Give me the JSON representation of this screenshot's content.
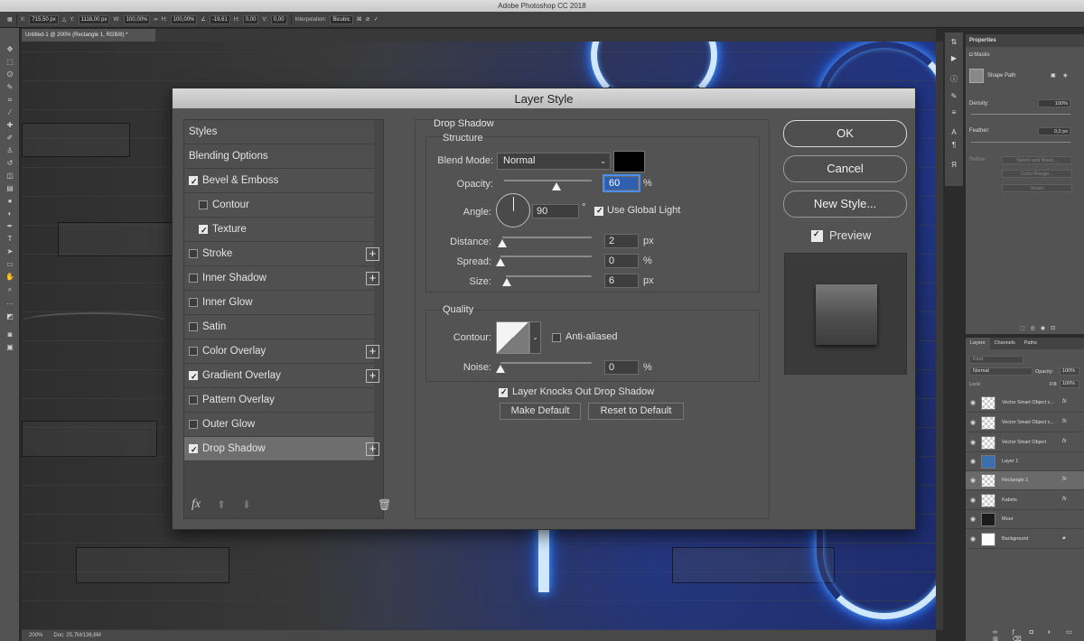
{
  "app": {
    "title": "Adobe Photoshop CC 2018"
  },
  "options_bar": {
    "x_label": "X:",
    "x_value": "715,50 px",
    "y_label": "Y:",
    "y_value": "1118,00 px",
    "w_label": "W:",
    "w_value": "100,00%",
    "h_label": "H:",
    "h_value": "100,00%",
    "angle_value": "-19,61",
    "hskew_label": "H:",
    "hskew_value": "0,00",
    "vskew_label": "V:",
    "vskew_value": "0,00",
    "interp_label": "Interpolation:",
    "interp_value": "Bicubic"
  },
  "document": {
    "tab": "Untitled-1 @ 200% (Rectangle 1, RGB/8) *"
  },
  "status": {
    "zoom": "200%",
    "doc": "Doc: 25,7M/136,6M"
  },
  "properties": {
    "title": "Properties",
    "masks": "Masks",
    "shape_path": "Shape Path",
    "density_label": "Density:",
    "density_value": "100%",
    "feather_label": "Feather:",
    "feather_value": "0,0 px",
    "refine_label": "Refine:",
    "btn_select_mask": "Select and Mask...",
    "btn_color_range": "Color Range...",
    "btn_invert": "Invert"
  },
  "layers_panel": {
    "tabs": [
      "Layers",
      "Channels",
      "Paths"
    ],
    "kind": "Kind",
    "blend": "Normal",
    "opacity_label": "Opacity:",
    "opacity_value": "100%",
    "lock_label": "Lock:",
    "fill_label": "Fill:",
    "fill_value": "100%",
    "layers": [
      {
        "name": "Vector Smart Object c...",
        "fx": "fx"
      },
      {
        "name": "Vector Smart Object c...",
        "fx": "fx"
      },
      {
        "name": "Vector Smart Object",
        "fx": "fx"
      },
      {
        "name": "Layer 1",
        "fx": ""
      },
      {
        "name": "Rectangle 1",
        "fx": "fx"
      },
      {
        "name": "Kabels",
        "fx": "fx"
      },
      {
        "name": "Muur",
        "fx": ""
      },
      {
        "name": "Background",
        "fx": ""
      }
    ]
  },
  "dialog": {
    "title": "Layer Style",
    "styles": [
      {
        "label": "Styles"
      },
      {
        "label": "Blending Options"
      },
      {
        "label": "Bevel & Emboss",
        "checked": true
      },
      {
        "label": "Contour",
        "checked": false
      },
      {
        "label": "Texture",
        "checked": true
      },
      {
        "label": "Stroke",
        "checked": false
      },
      {
        "label": "Inner Shadow",
        "checked": false
      },
      {
        "label": "Inner Glow",
        "checked": false
      },
      {
        "label": "Satin",
        "checked": false
      },
      {
        "label": "Color Overlay",
        "checked": false
      },
      {
        "label": "Gradient Overlay",
        "checked": true
      },
      {
        "label": "Pattern Overlay",
        "checked": false
      },
      {
        "label": "Outer Glow",
        "checked": false
      },
      {
        "label": "Drop Shadow",
        "checked": true
      }
    ],
    "fx_label": "fx",
    "section_title": "Drop Shadow",
    "structure": {
      "title": "Structure",
      "blend_mode_label": "Blend Mode:",
      "blend_mode_value": "Normal",
      "shadow_color": "#000000",
      "opacity_label": "Opacity:",
      "opacity_value": "60",
      "opacity_unit": "%",
      "angle_label": "Angle:",
      "angle_value": "90",
      "angle_unit": "°",
      "use_global_light": "Use Global Light",
      "distance_label": "Distance:",
      "distance_value": "2",
      "distance_unit": "px",
      "spread_label": "Spread:",
      "spread_value": "0",
      "spread_unit": "%",
      "size_label": "Size:",
      "size_value": "6",
      "size_unit": "px"
    },
    "quality": {
      "title": "Quality",
      "contour_label": "Contour:",
      "anti_aliased": "Anti-aliased",
      "noise_label": "Noise:",
      "noise_value": "0",
      "noise_unit": "%"
    },
    "knockout_label": "Layer Knocks Out Drop Shadow",
    "make_default": "Make Default",
    "reset_default": "Reset to Default",
    "buttons": {
      "ok": "OK",
      "cancel": "Cancel",
      "new_style": "New Style..."
    },
    "preview_label": "Preview"
  }
}
